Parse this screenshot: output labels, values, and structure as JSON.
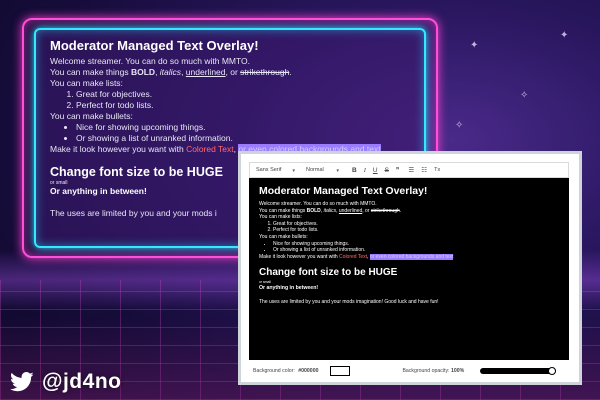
{
  "overlay": {
    "title": "Moderator Managed Text Overlay!",
    "intro": "Welcome streamer. You can do so much with MMTO.",
    "formats": {
      "prefix": "You can make things ",
      "bold": "BOLD",
      "sep1": ", ",
      "italic": "italics",
      "sep2": ", ",
      "underline": "underlined",
      "sep3": ", or ",
      "strike": "strikethrough",
      "suffix": "."
    },
    "lists_label": "You can make lists:",
    "numbered": [
      "Great for objectives.",
      "Perfect for todo lists."
    ],
    "bullets_label": "You can make bullets:",
    "bullets": [
      "Nice for showing upcoming things.",
      "Or showing a list of unranked information."
    ],
    "color_prefix": "Make it look however you want with ",
    "colored_text": "Colored Text",
    "color_sep": ", ",
    "highlighted_text": "or even colored backgrounds and text",
    "huge_heading": "Change font size to be HUGE",
    "small_text": "or small",
    "between_text": "Or anything in between!",
    "closing_truncated": "The uses are limited by you and your mods i"
  },
  "editor": {
    "toolbar": {
      "font": "Sans Serif",
      "size": "Normal",
      "bold": "B",
      "italic": "I",
      "underline": "U",
      "strike": "S",
      "quote": "❞",
      "ordered_list": "☰",
      "bullet_list": "☷",
      "clear": "Tx"
    },
    "content": {
      "title": "Moderator Managed Text Overlay!",
      "intro": "Welcome streamer. You can do so much with MMTO.",
      "formats": {
        "prefix": "You can make things ",
        "bold": "BOLD",
        "sep1": ", ",
        "italic": "italics",
        "sep2": ", ",
        "underline": "underlined",
        "sep3": ", or ",
        "strike": "strikethrough",
        "suffix": "."
      },
      "lists_label": "You can make lists:",
      "numbered": [
        "Great for objectives.",
        "Perfect for todo lists."
      ],
      "bullets_label": "You can make bullets:",
      "bullets": [
        "Nice for showing upcoming things.",
        "Or showing a list of unranked information."
      ],
      "color_prefix": "Make it look however you want with ",
      "colored_text": "Colored Text",
      "color_sep": ", ",
      "highlighted_text": "or even colored backgrounds and text",
      "huge_heading": "Change font size to be HUGE",
      "small_text": "or small",
      "between_text": "Or anything in between!",
      "closing": "The uses are limited by you and your mods imagination! Good luck and have fun!"
    },
    "footer": {
      "bg_color_label": "Background color:",
      "bg_color_value": "#000000",
      "bg_opacity_label": "Background opacity:",
      "bg_opacity_value": "100%",
      "opacity_fraction": 1.0
    }
  },
  "twitter_handle": "@jd4no",
  "colors": {
    "colored_text": "#ff6b6b",
    "highlight_bg": "#9a7dff",
    "frame_pink": "#ff4fd8",
    "frame_cyan": "#36e8ff",
    "editor_bg": "#000000"
  }
}
